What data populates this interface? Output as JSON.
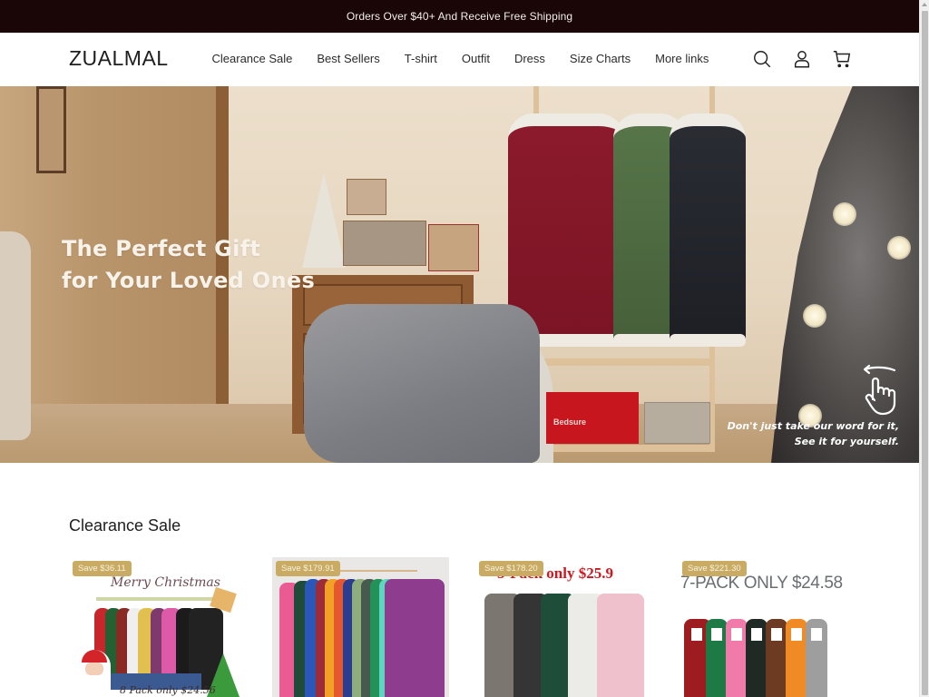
{
  "announcement": {
    "text": "Orders Over $40+ And Receive Free Shipping"
  },
  "header": {
    "logo": "ZUALMAL",
    "nav": [
      {
        "label": "Clearance Sale"
      },
      {
        "label": "Best Sellers"
      },
      {
        "label": "T-shirt"
      },
      {
        "label": "Outfit"
      },
      {
        "label": "Dress"
      },
      {
        "label": "Size Charts"
      },
      {
        "label": "More links"
      }
    ],
    "icons": [
      "search-icon",
      "account-icon",
      "cart-icon"
    ]
  },
  "hero": {
    "title_line1": "The Perfect Gift",
    "title_line2": "for Your Loved Ones",
    "caption_line1": "Don't just take our word for it,",
    "caption_line2": "See it for yourself.",
    "box_label": "Bedsure",
    "icon": "swipe-hand-icon"
  },
  "section": {
    "title": "Clearance Sale",
    "products": [
      {
        "badge": "Save $36.11",
        "image_text_top": "Merry Christmas",
        "image_text_bottom": "8 Pack only $24.56"
      },
      {
        "badge": "Save $179.91"
      },
      {
        "badge": "Save $178.20",
        "image_text_top": "3-Pack only $25.9"
      },
      {
        "badge": "Save $221.30",
        "image_text_top": "7-PACK ONLY $24.58"
      }
    ]
  },
  "colors": {
    "announcement_bg": "#1a0507",
    "badge_bg": "#c9ab63",
    "accent_red": "#d0161f"
  }
}
